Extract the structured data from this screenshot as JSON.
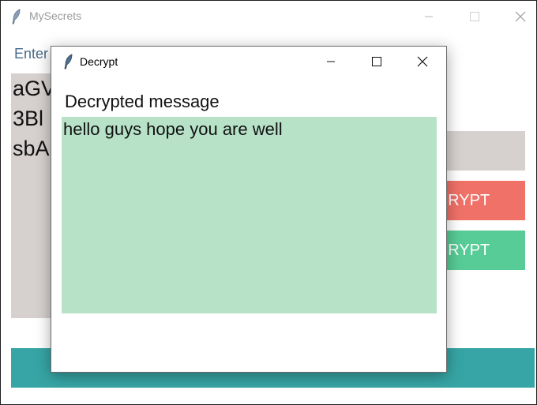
{
  "main_window": {
    "title": "MySecrets",
    "enter_label": "Enter",
    "cipher_lines": [
      "aGV",
      "3Bl",
      "sbA"
    ],
    "encrypt_label": "ENCRYPT",
    "decrypt_label": "DECRYPT",
    "icons": {
      "app": "feather-icon",
      "minimize": "minimize-icon",
      "maximize": "maximize-icon",
      "close": "close-icon"
    }
  },
  "dialog": {
    "title": "Decrypt",
    "heading": "Decrypted message",
    "message": "hello guys hope you are well",
    "icons": {
      "app": "feather-icon",
      "minimize": "minimize-icon",
      "maximize": "maximize-icon",
      "close": "close-icon"
    }
  },
  "colors": {
    "encrypt_button": "#ef7168",
    "decrypt_button": "#57cc96",
    "reset_button": "#37a5a5",
    "input_background": "#d6d1cf",
    "decrypted_text_background": "#b7e2c7"
  }
}
